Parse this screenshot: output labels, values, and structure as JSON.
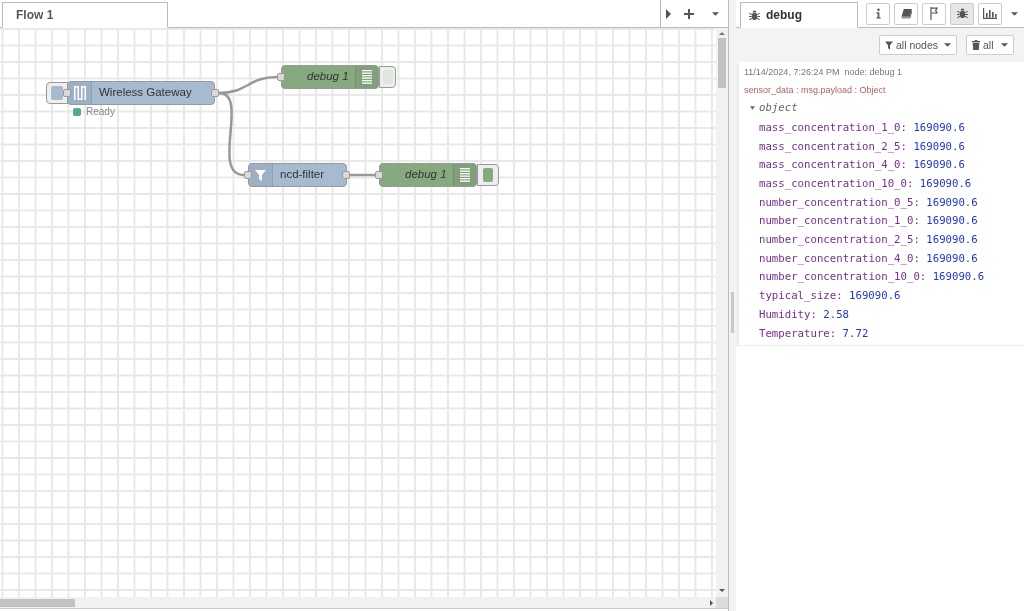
{
  "workspace": {
    "tabs": [
      {
        "label": "Flow 1",
        "selected": true
      }
    ]
  },
  "nodes": [
    {
      "kind": "gateway",
      "label": "Wireless Gateway",
      "status": {
        "text": "Ready",
        "color": "#55aa88"
      }
    },
    {
      "kind": "debug",
      "label": "debug 1",
      "active": false
    },
    {
      "kind": "filter",
      "label": "ncd-filter"
    },
    {
      "kind": "debug",
      "label": "debug 1",
      "active": true
    }
  ],
  "sidebar": {
    "tabs": [
      {
        "label": "debug",
        "selected": true
      }
    ],
    "buttons": [
      {
        "kind": "info",
        "selected": false
      },
      {
        "kind": "book",
        "selected": false
      },
      {
        "kind": "flag",
        "selected": false
      },
      {
        "kind": "bug",
        "selected": true
      },
      {
        "kind": "chart",
        "selected": false
      }
    ],
    "filters": [
      {
        "kind": "nodes",
        "label": "all nodes"
      },
      {
        "kind": "clear",
        "label": "all"
      }
    ],
    "messages": [
      {
        "timestamp": "11/14/2024, 7:26:24 PM",
        "node": "node: debug 1",
        "source": "sensor_data : msg.payload : Object",
        "payload": {
          "label": "object",
          "expanded": true,
          "properties": [
            {
              "key": "mass_concentration_1_0:",
              "value": "169090.6"
            },
            {
              "key": "mass_concentration_2_5:",
              "value": "169090.6"
            },
            {
              "key": "mass_concentration_4_0:",
              "value": "169090.6"
            },
            {
              "key": "mass_concentration_10_0:",
              "value": "169090.6"
            },
            {
              "key": "number_concentration_0_5:",
              "value": "169090.6"
            },
            {
              "key": "number_concentration_1_0:",
              "value": "169090.6"
            },
            {
              "key": "number_concentration_2_5:",
              "value": "169090.6"
            },
            {
              "key": "number_concentration_4_0:",
              "value": "169090.6"
            },
            {
              "key": "number_concentration_10_0:",
              "value": "169090.6"
            },
            {
              "key": "typical_size:",
              "value": "169090.6"
            },
            {
              "key": "Humidity:",
              "value": "2.58"
            },
            {
              "key": "Temperature:",
              "value": "7.72"
            }
          ]
        }
      }
    ]
  }
}
